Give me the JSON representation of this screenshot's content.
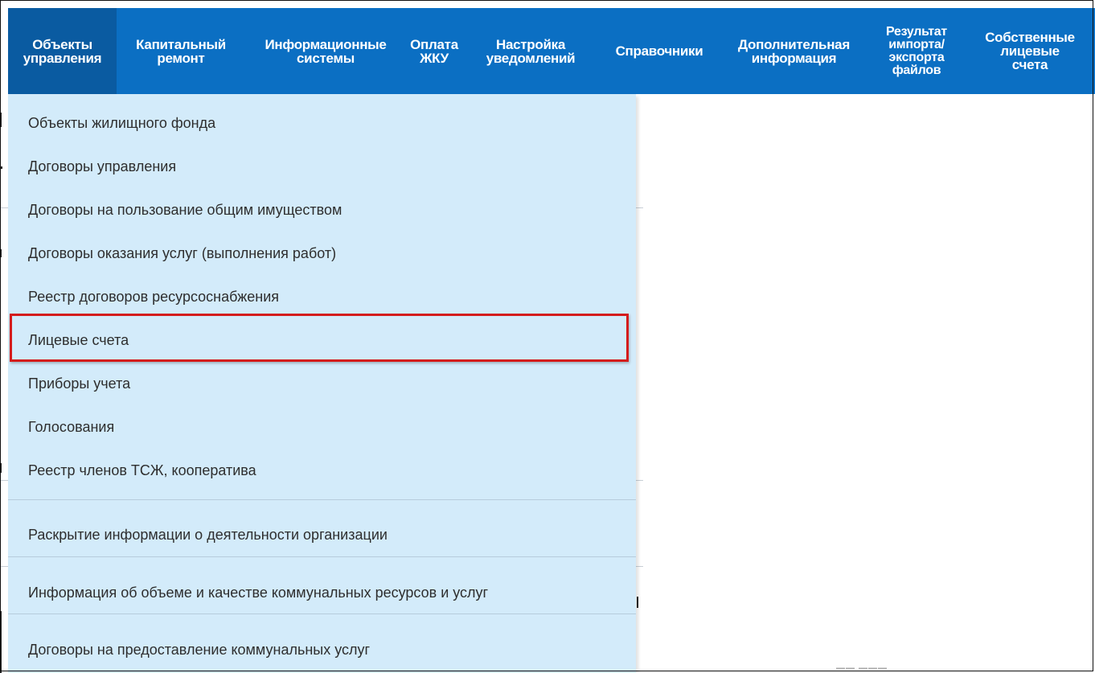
{
  "nav": {
    "items": [
      {
        "label": "Объекты\nуправления",
        "active": true
      },
      {
        "label": "Капитальный\nремонт"
      },
      {
        "label": "Информационные\nсистемы"
      },
      {
        "label": "Оплата\nЖКУ"
      },
      {
        "label": "Настройка\nуведомлений"
      },
      {
        "label": "Справочники"
      },
      {
        "label": "Дополнительная\nинформация"
      },
      {
        "label": "Результат\nимпорта/\nэкспорта\nфайлов"
      },
      {
        "label": "Собственные\nлицевые\nсчета"
      }
    ]
  },
  "dropdown": {
    "items": [
      {
        "label": "Объекты жилищного фонда"
      },
      {
        "label": "Договоры управления"
      },
      {
        "label": "Договоры на пользование общим имуществом"
      },
      {
        "label": "Договоры оказания услуг (выполнения работ)"
      },
      {
        "label": "Реестр договоров ресурсоснабжения"
      },
      {
        "label": "Лицевые счета",
        "highlighted": true
      },
      {
        "label": "Приборы учета"
      },
      {
        "label": "Голосования"
      },
      {
        "label": "Реестр членов ТСЖ, кооператива"
      },
      {
        "label": "Раскрытие информации о деятельности организации"
      },
      {
        "label": "Информация об объеме и качестве коммунальных ресурсов и услуг"
      },
      {
        "label": "Договоры на предоставление коммунальных услуг"
      }
    ]
  },
  "colors": {
    "nav_bg": "#0b6fc3",
    "nav_active_bg": "#0a5ba1",
    "dropdown_bg": "#d3ebfa",
    "highlight_border": "#d41c1c"
  }
}
